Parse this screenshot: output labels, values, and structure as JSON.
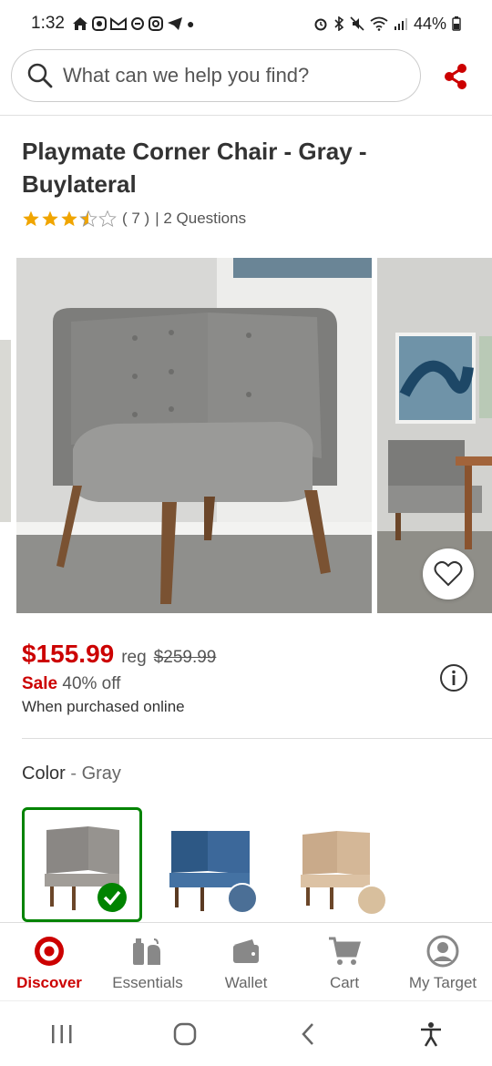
{
  "status_bar": {
    "time": "1:32",
    "battery": "44%"
  },
  "search": {
    "placeholder": "What can we help you find?"
  },
  "product": {
    "title": "Playmate Corner Chair - Gray - Buylateral",
    "rating": 3.5,
    "rating_max": 5,
    "review_count_text": "( 7 )",
    "questions_text": "| 2 Questions"
  },
  "pricing": {
    "current": "$155.99",
    "reg_label": "reg",
    "regular": "$259.99",
    "sale_label": "Sale",
    "sale_off": "40% off",
    "online_note": "When purchased online"
  },
  "color": {
    "label": "Color",
    "separator": " - ",
    "selected": "Gray",
    "swatches": [
      {
        "name": "gray",
        "selected": true
      },
      {
        "name": "blue",
        "selected": false
      },
      {
        "name": "tan",
        "selected": false
      }
    ]
  },
  "bottom_nav": {
    "items": [
      {
        "label": "Discover",
        "icon": "target-logo-icon",
        "active": true
      },
      {
        "label": "Essentials",
        "icon": "essentials-icon",
        "active": false
      },
      {
        "label": "Wallet",
        "icon": "wallet-icon",
        "active": false
      },
      {
        "label": "Cart",
        "icon": "cart-icon",
        "active": false
      },
      {
        "label": "My Target",
        "icon": "account-icon",
        "active": false
      }
    ]
  },
  "colors": {
    "accent_red": "#cc0000",
    "selected_green": "#008300"
  }
}
